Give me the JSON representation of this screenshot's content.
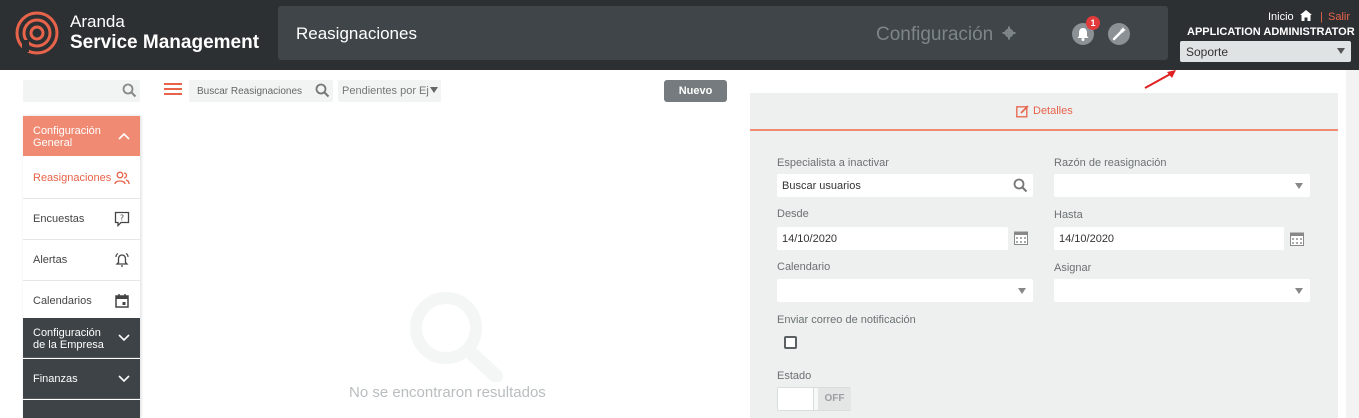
{
  "brand": {
    "line1": "Aranda",
    "line2": "Service Management"
  },
  "header": {
    "page_title": "Reasignaciones",
    "config_label": "Configuración",
    "notification_count": "1",
    "home_label": "Inicio",
    "separator": "|",
    "logout_label": "Salir",
    "user_name": "APPLICATION ADMINISTRATOR",
    "role_value": "Soporte"
  },
  "sidebar": {
    "sections": [
      {
        "label": "Configuración General",
        "state": "expanded"
      },
      {
        "label": "Configuración de la Empresa",
        "state": "collapsed"
      },
      {
        "label": "Finanzas",
        "state": "collapsed"
      }
    ],
    "items": [
      {
        "label": "Reasignaciones",
        "icon": "users-icon",
        "active": true
      },
      {
        "label": "Encuestas",
        "icon": "survey-icon",
        "active": false
      },
      {
        "label": "Alertas",
        "icon": "alarm-icon",
        "active": false
      },
      {
        "label": "Calendarios",
        "icon": "calendar-icon",
        "active": false
      }
    ]
  },
  "list": {
    "search_placeholder": "Buscar Reasignaciones",
    "filter_value": "Pendientes por Ej",
    "new_button": "Nuevo",
    "empty_message": "No se encontraron resultados"
  },
  "details": {
    "tab_label": "Detalles",
    "fields": {
      "specialist_label": "Especialista a inactivar",
      "specialist_value": "Buscar usuarios",
      "reason_label": "Razón de reasignación",
      "reason_value": "",
      "from_label": "Desde",
      "from_value": "14/10/2020",
      "to_label": "Hasta",
      "to_value": "14/10/2020",
      "calendar_label": "Calendario",
      "calendar_value": "",
      "assign_label": "Asignar",
      "assign_value": "",
      "email_label": "Enviar correo de notificación",
      "email_checked": false,
      "status_label": "Estado",
      "status_value": "OFF"
    }
  },
  "colors": {
    "header_bg": "#2c3033",
    "accent": "#e7634a",
    "active_section": "#f08a72",
    "dark_section": "#3d4347",
    "panel_bg": "#eef0f0"
  }
}
